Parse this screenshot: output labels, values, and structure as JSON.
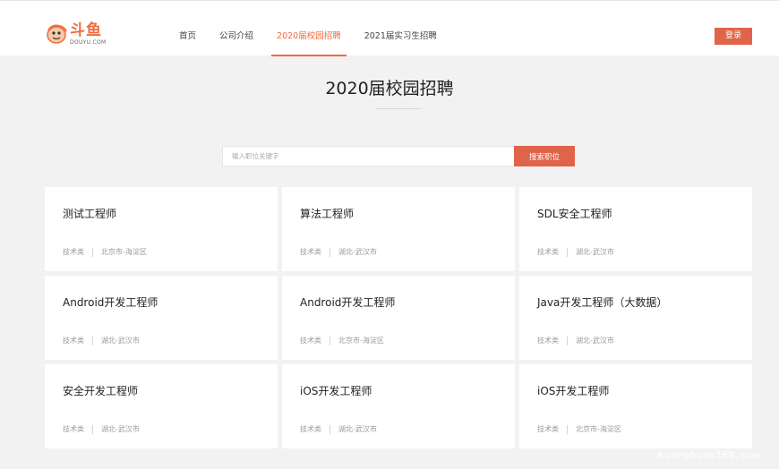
{
  "header": {
    "logo_cn": "斗鱼",
    "logo_en": "DOUYU.COM",
    "nav": [
      {
        "label": "首页"
      },
      {
        "label": "公司介绍"
      },
      {
        "label": "2020届校园招聘"
      },
      {
        "label": "2021届实习生招聘"
      }
    ],
    "active_nav": "2020届校园招聘",
    "login_label": "登录"
  },
  "main": {
    "title": "2020届校园招聘",
    "search": {
      "placeholder": "输入职位关键字",
      "value": "",
      "button_label": "搜索职位"
    },
    "jobs": [
      {
        "title": "测试工程师",
        "category": "技术类",
        "location": "北京市-海淀区"
      },
      {
        "title": "算法工程师",
        "category": "技术类",
        "location": "湖北-武汉市"
      },
      {
        "title": "SDL安全工程师",
        "category": "技术类",
        "location": "湖北-武汉市"
      },
      {
        "title": "Android开发工程师",
        "category": "技术类",
        "location": "湖北-武汉市"
      },
      {
        "title": "Android开发工程师",
        "category": "技术类",
        "location": "北京市-海淀区"
      },
      {
        "title": "Java开发工程师（大数据）",
        "category": "技术类",
        "location": "湖北-武汉市"
      },
      {
        "title": "安全开发工程师",
        "category": "技术类",
        "location": "湖北-武汉市"
      },
      {
        "title": "iOS开发工程师",
        "category": "技术类",
        "location": "湖北-武汉市"
      },
      {
        "title": "iOS开发工程师",
        "category": "技术类",
        "location": "北京市-海淀区"
      }
    ]
  },
  "watermark": "kuanghuan168.com",
  "colors": {
    "accent": "#e0644a",
    "active_nav": "#f26b3a",
    "background": "#f2f2f2",
    "card": "#ffffff"
  }
}
